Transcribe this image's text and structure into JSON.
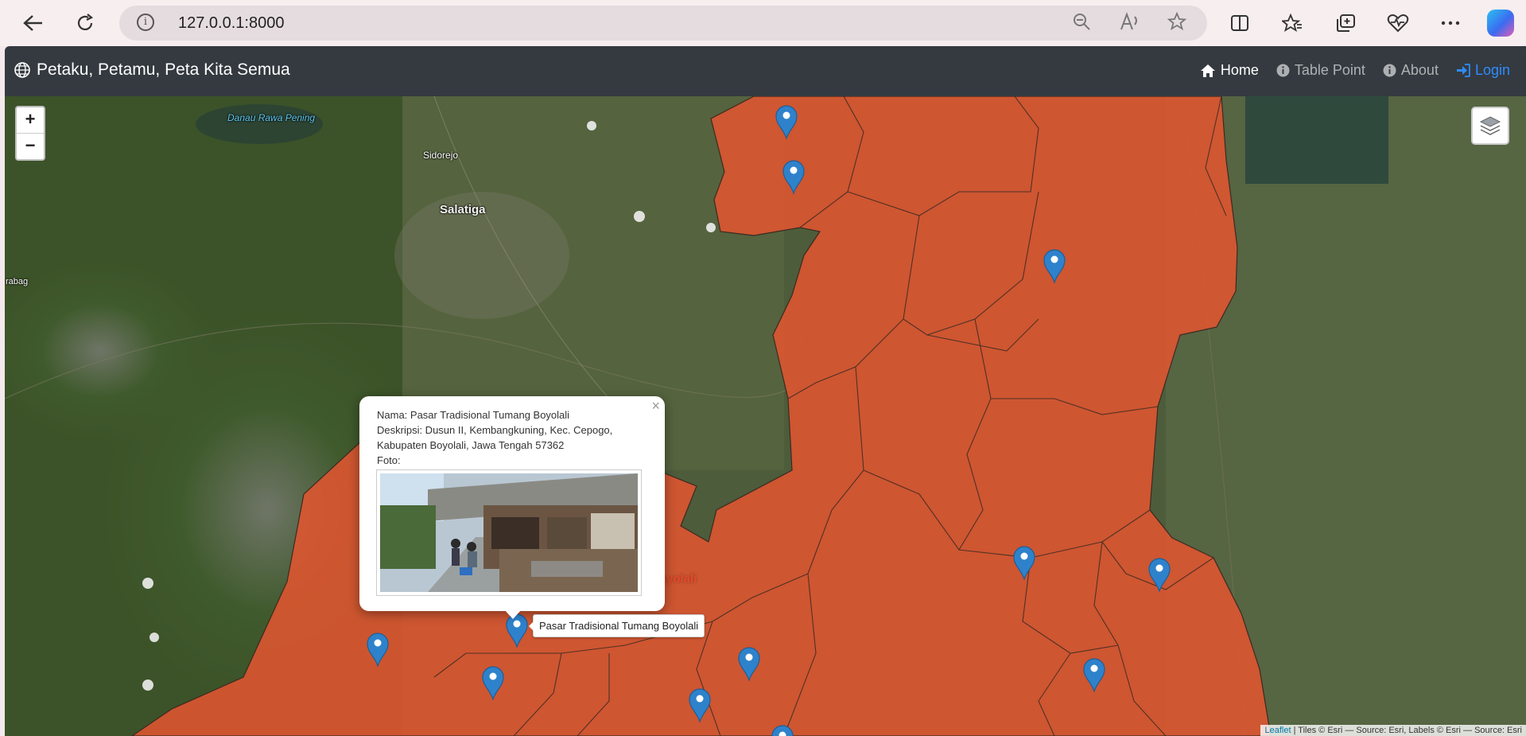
{
  "browser": {
    "url": "127.0.0.1:8000",
    "icons": [
      "back-icon",
      "refresh-icon",
      "info-icon",
      "zoom-out-icon",
      "read-aloud-icon",
      "favorite-star-icon",
      "split-screen-icon",
      "favorites-icon",
      "collections-icon",
      "health-icon",
      "more-icon",
      "copilot-icon"
    ]
  },
  "navbar": {
    "brand": "Petaku, Petamu, Peta Kita Semua",
    "links": {
      "home": "Home",
      "table_point": "Table Point",
      "about": "About",
      "login": "Login"
    },
    "active_color": "#ffffff",
    "login_color": "#2f8cff"
  },
  "map": {
    "zoom_in": "+",
    "zoom_out": "−",
    "labels": {
      "lake": "Danau Rawa Pening",
      "sidorejo": "Sidorejo",
      "salatiga": "Salatiga",
      "rabag": "rabag",
      "boyolali": "Boyolali"
    },
    "region_color": "#e25530",
    "marker_color": "#2e82cb",
    "popup": {
      "close": "×",
      "nama": "Nama: Pasar Tradisional Tumang Boyolali",
      "deskripsi": "Deskripsi: Dusun II, Kembangkuning, Kec. Cepogo, Kabupaten Boyolali, Jawa Tengah 57362",
      "foto": "Foto:"
    },
    "tooltip": "Pasar Tradisional Tumang Boyolali",
    "attribution": {
      "leaflet": "Leaflet",
      "rest": " | Tiles © Esri — Source: Esri, Labels © Esri — Source: Esri"
    }
  }
}
